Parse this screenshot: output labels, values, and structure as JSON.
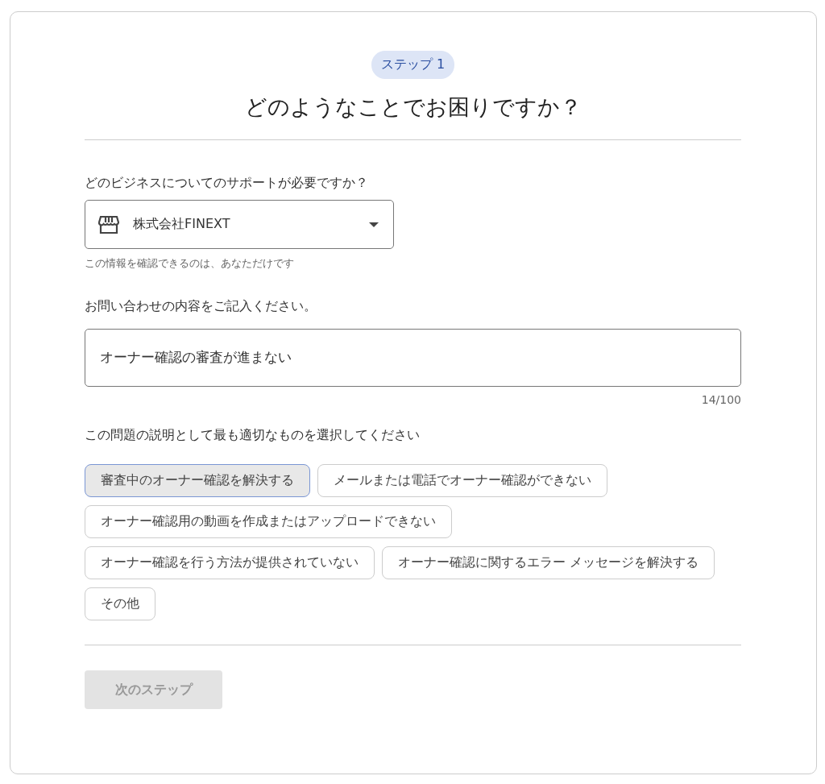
{
  "step_badge": "ステップ 1",
  "title": "どのようなことでお困りですか？",
  "business": {
    "label": "どのビジネスについてのサポートが必要ですか？",
    "value": "株式会社FINEXT",
    "hint": "この情報を確認できるのは、あなただけです"
  },
  "inquiry": {
    "label": "お問い合わせの内容をご記入ください。",
    "value": "オーナー確認の審査が進まない",
    "counter": "14/100"
  },
  "options_label": "この問題の説明として最も適切なものを選択してください",
  "options": [
    {
      "label": "審査中のオーナー確認を解決する",
      "selected": true
    },
    {
      "label": "メールまたは電話でオーナー確認ができない",
      "selected": false
    },
    {
      "label": "オーナー確認用の動画を作成またはアップロードできない",
      "selected": false
    },
    {
      "label": "オーナー確認を行う方法が提供されていない",
      "selected": false
    },
    {
      "label": "オーナー確認に関するエラー メッセージを解決する",
      "selected": false
    },
    {
      "label": "その他",
      "selected": false
    }
  ],
  "next_button": {
    "label": "次のステップ",
    "disabled": true
  }
}
